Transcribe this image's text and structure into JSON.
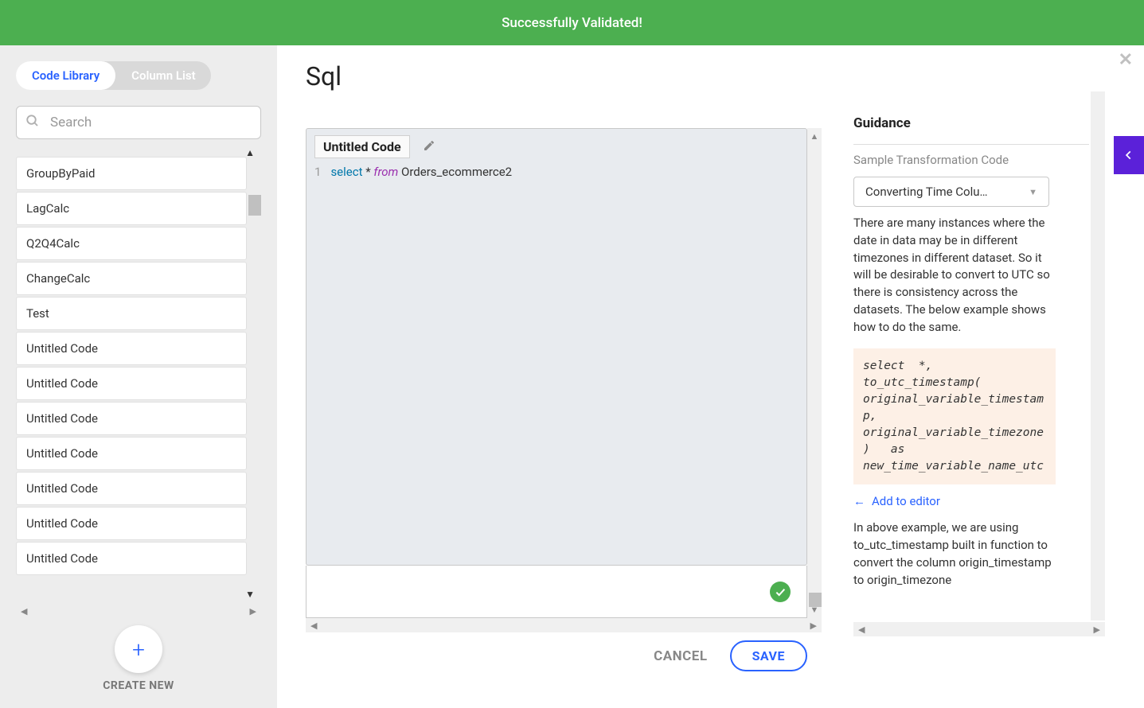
{
  "banner": {
    "message": "Successfully Validated!"
  },
  "sidebar": {
    "tabs": {
      "code_library": "Code Library",
      "column_list": "Column List"
    },
    "search_placeholder": "Search",
    "items": [
      {
        "label": "GroupByPaid"
      },
      {
        "label": "LagCalc"
      },
      {
        "label": "Q2Q4Calc"
      },
      {
        "label": "ChangeCalc"
      },
      {
        "label": "Test"
      },
      {
        "label": "Untitled Code"
      },
      {
        "label": "Untitled Code"
      },
      {
        "label": "Untitled Code"
      },
      {
        "label": "Untitled Code"
      },
      {
        "label": "Untitled Code"
      },
      {
        "label": "Untitled Code"
      },
      {
        "label": "Untitled Code"
      }
    ],
    "create_new": "CREATE NEW"
  },
  "main": {
    "title": "Sql",
    "code_name": "Untitled Code",
    "code": {
      "line_no": "1",
      "kw_select": "select",
      "star": " * ",
      "kw_from": "from",
      "table": " Orders_ecommerce2"
    },
    "cancel": "CANCEL",
    "save": "SAVE"
  },
  "guidance": {
    "title": "Guidance",
    "subtitle": "Sample Transformation Code",
    "dropdown_selected": "Converting Time Colu…",
    "para1": "There are many instances where the date in data may be in different timezones in different dataset. So it will be desirable to convert to UTC so there is consistency across the datasets. The below example shows how to do the same.",
    "code_sample": "select  *,  to_utc_timestamp( original_variable_timestamp, original_variable_timezone)   as new_time_variable_name_utc",
    "add_to_editor": "Add to editor",
    "para2": "In above example, we are using to_utc_timestamp built in function to convert the column origin_timestamp to origin_timezone"
  }
}
